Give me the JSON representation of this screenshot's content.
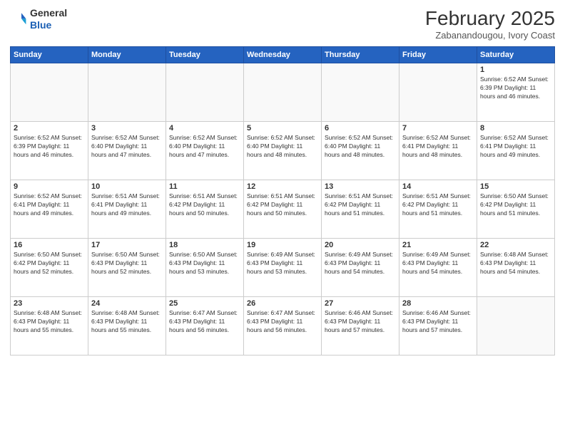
{
  "header": {
    "logo_general": "General",
    "logo_blue": "Blue",
    "month": "February 2025",
    "location": "Zabanandougou, Ivory Coast"
  },
  "weekdays": [
    "Sunday",
    "Monday",
    "Tuesday",
    "Wednesday",
    "Thursday",
    "Friday",
    "Saturday"
  ],
  "weeks": [
    [
      {
        "day": "",
        "info": ""
      },
      {
        "day": "",
        "info": ""
      },
      {
        "day": "",
        "info": ""
      },
      {
        "day": "",
        "info": ""
      },
      {
        "day": "",
        "info": ""
      },
      {
        "day": "",
        "info": ""
      },
      {
        "day": "1",
        "info": "Sunrise: 6:52 AM\nSunset: 6:39 PM\nDaylight: 11 hours and 46 minutes."
      }
    ],
    [
      {
        "day": "2",
        "info": "Sunrise: 6:52 AM\nSunset: 6:39 PM\nDaylight: 11 hours and 46 minutes."
      },
      {
        "day": "3",
        "info": "Sunrise: 6:52 AM\nSunset: 6:40 PM\nDaylight: 11 hours and 47 minutes."
      },
      {
        "day": "4",
        "info": "Sunrise: 6:52 AM\nSunset: 6:40 PM\nDaylight: 11 hours and 47 minutes."
      },
      {
        "day": "5",
        "info": "Sunrise: 6:52 AM\nSunset: 6:40 PM\nDaylight: 11 hours and 48 minutes."
      },
      {
        "day": "6",
        "info": "Sunrise: 6:52 AM\nSunset: 6:40 PM\nDaylight: 11 hours and 48 minutes."
      },
      {
        "day": "7",
        "info": "Sunrise: 6:52 AM\nSunset: 6:41 PM\nDaylight: 11 hours and 48 minutes."
      },
      {
        "day": "8",
        "info": "Sunrise: 6:52 AM\nSunset: 6:41 PM\nDaylight: 11 hours and 49 minutes."
      }
    ],
    [
      {
        "day": "9",
        "info": "Sunrise: 6:52 AM\nSunset: 6:41 PM\nDaylight: 11 hours and 49 minutes."
      },
      {
        "day": "10",
        "info": "Sunrise: 6:51 AM\nSunset: 6:41 PM\nDaylight: 11 hours and 49 minutes."
      },
      {
        "day": "11",
        "info": "Sunrise: 6:51 AM\nSunset: 6:42 PM\nDaylight: 11 hours and 50 minutes."
      },
      {
        "day": "12",
        "info": "Sunrise: 6:51 AM\nSunset: 6:42 PM\nDaylight: 11 hours and 50 minutes."
      },
      {
        "day": "13",
        "info": "Sunrise: 6:51 AM\nSunset: 6:42 PM\nDaylight: 11 hours and 51 minutes."
      },
      {
        "day": "14",
        "info": "Sunrise: 6:51 AM\nSunset: 6:42 PM\nDaylight: 11 hours and 51 minutes."
      },
      {
        "day": "15",
        "info": "Sunrise: 6:50 AM\nSunset: 6:42 PM\nDaylight: 11 hours and 51 minutes."
      }
    ],
    [
      {
        "day": "16",
        "info": "Sunrise: 6:50 AM\nSunset: 6:42 PM\nDaylight: 11 hours and 52 minutes."
      },
      {
        "day": "17",
        "info": "Sunrise: 6:50 AM\nSunset: 6:43 PM\nDaylight: 11 hours and 52 minutes."
      },
      {
        "day": "18",
        "info": "Sunrise: 6:50 AM\nSunset: 6:43 PM\nDaylight: 11 hours and 53 minutes."
      },
      {
        "day": "19",
        "info": "Sunrise: 6:49 AM\nSunset: 6:43 PM\nDaylight: 11 hours and 53 minutes."
      },
      {
        "day": "20",
        "info": "Sunrise: 6:49 AM\nSunset: 6:43 PM\nDaylight: 11 hours and 54 minutes."
      },
      {
        "day": "21",
        "info": "Sunrise: 6:49 AM\nSunset: 6:43 PM\nDaylight: 11 hours and 54 minutes."
      },
      {
        "day": "22",
        "info": "Sunrise: 6:48 AM\nSunset: 6:43 PM\nDaylight: 11 hours and 54 minutes."
      }
    ],
    [
      {
        "day": "23",
        "info": "Sunrise: 6:48 AM\nSunset: 6:43 PM\nDaylight: 11 hours and 55 minutes."
      },
      {
        "day": "24",
        "info": "Sunrise: 6:48 AM\nSunset: 6:43 PM\nDaylight: 11 hours and 55 minutes."
      },
      {
        "day": "25",
        "info": "Sunrise: 6:47 AM\nSunset: 6:43 PM\nDaylight: 11 hours and 56 minutes."
      },
      {
        "day": "26",
        "info": "Sunrise: 6:47 AM\nSunset: 6:43 PM\nDaylight: 11 hours and 56 minutes."
      },
      {
        "day": "27",
        "info": "Sunrise: 6:46 AM\nSunset: 6:43 PM\nDaylight: 11 hours and 57 minutes."
      },
      {
        "day": "28",
        "info": "Sunrise: 6:46 AM\nSunset: 6:43 PM\nDaylight: 11 hours and 57 minutes."
      },
      {
        "day": "",
        "info": ""
      }
    ]
  ]
}
